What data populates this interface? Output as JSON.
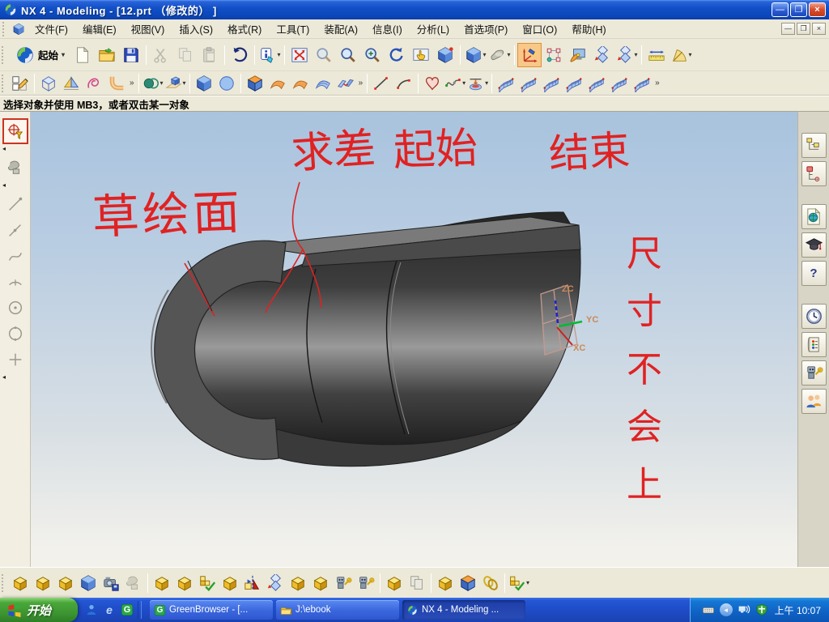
{
  "titlebar": {
    "title": "NX 4 - Modeling - [12.prt （修改的） ]"
  },
  "menubar": {
    "items": [
      "文件(F)",
      "编辑(E)",
      "视图(V)",
      "插入(S)",
      "格式(R)",
      "工具(T)",
      "装配(A)",
      "信息(I)",
      "分析(L)",
      "首选项(P)",
      "窗口(O)",
      "帮助(H)"
    ]
  },
  "toolbar_standard": {
    "start_label": "起始"
  },
  "prompt_bar": {
    "message": "选择对象并使用 MB3，或者双击某一对象"
  },
  "graphics": {
    "annotations": {
      "subtract": "求差",
      "start": "起始",
      "end": "结束",
      "sketch_face": "草绘面",
      "dimension_note": "尺寸不会上"
    },
    "wcs": {
      "z": "ZC",
      "y": "YC",
      "x": "XC"
    }
  },
  "icons": {
    "minimize": "—",
    "restore": "❐",
    "close": "×",
    "mdi_minimize": "—",
    "mdi_restore": "❐",
    "mdi_close": "×",
    "dropdown": "▾",
    "overflow": "»",
    "collapse": "◂",
    "help": "?",
    "green_g": "G",
    "ie_e": "e",
    "named": [
      "nx-logo",
      "new-file",
      "open-folder",
      "save",
      "cut",
      "copy",
      "paste",
      "undo",
      "info-tag",
      "fit-view",
      "zoom-box",
      "zoom-loupe",
      "zoom-in-out",
      "rotate-view",
      "pan-view",
      "perspective-cube",
      "iso-view-cube",
      "shaded-view",
      "orient-csys",
      "snap-points",
      "view-wizard",
      "step-diamonds",
      "measure-distance",
      "measure-angle",
      "sketch",
      "datum-plane",
      "datum-csys",
      "curve",
      "tube-elbow",
      "boolean-unite",
      "extrude",
      "block",
      "sphere",
      "trim-body",
      "swept-sheet",
      "sheet-surface",
      "sew",
      "line",
      "arc",
      "profile",
      "spline",
      "pad",
      "mesh-surface",
      "assembly-cube",
      "snapshot-camera",
      "wave-link",
      "check-mate",
      "mirror-assembly",
      "assembly-navigator",
      "part-navigator",
      "web-browser",
      "training",
      "help-bubble",
      "history-clock",
      "palette",
      "system-robot",
      "roles-people",
      "snap-crosshair",
      "snap-robot",
      "snap-endpoint",
      "snap-midpoint",
      "snap-curve",
      "snap-arc-center",
      "snap-circle-center",
      "snap-circle",
      "snap-point",
      "keyboard-tray",
      "hide-icons-chevron",
      "network-tray",
      "shield-tray",
      "windows-flag",
      "messenger-person",
      "greenbrowser-g",
      "folder-task"
    ]
  },
  "taskbar": {
    "start_label": "开始",
    "tasks": [
      {
        "label": "GreenBrowser - [..."
      },
      {
        "label": "J:\\ebook"
      },
      {
        "label": "NX 4 - Modeling ..."
      }
    ],
    "tray": {
      "time": "上午 10:07"
    }
  }
}
